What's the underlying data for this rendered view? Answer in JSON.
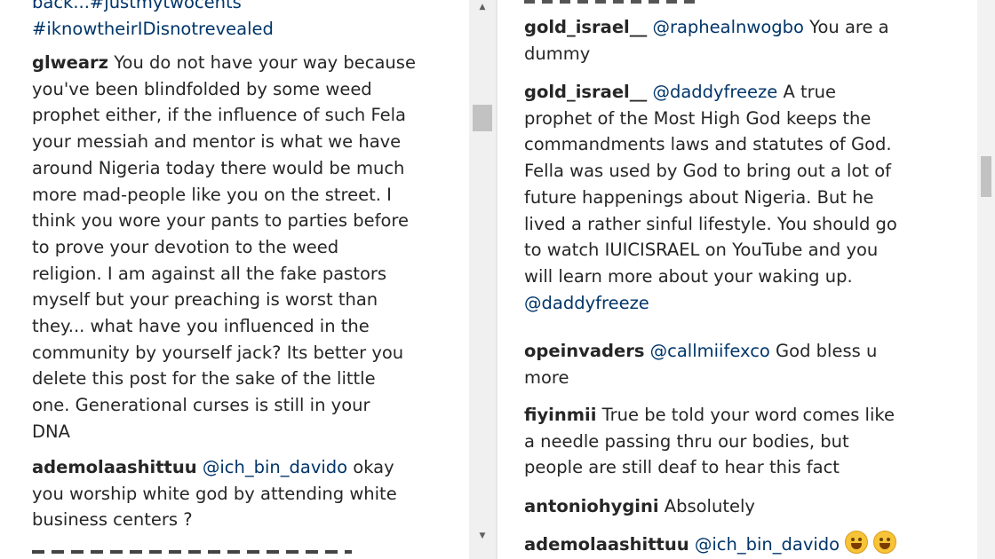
{
  "left": {
    "partial_top": [
      "back...#justmytwocents",
      "#iknowtheirIDisnotrevealed"
    ],
    "comment1": {
      "user": "glwearz",
      "lines": [
        " You do not have your way because",
        "you've been blindfolded by some weed",
        "prophet either, if the influence of such Fela",
        "your messiah and mentor is what we have",
        "around Nigeria today there would be much",
        "more mad-people like you on the street. I",
        "think you wore your pants to parties before",
        "to prove your devotion to the weed",
        "religion. I am against all the fake pastors",
        "myself but your preaching is worst than",
        "they... what have you influenced in the",
        "community by yourself jack? Its better you",
        "delete this post for the sake of the little",
        "one. Generational curses is still in your",
        "DNA"
      ]
    },
    "comment2": {
      "user": "ademolaashittuu",
      "mention": "@ich_bin_davido",
      "lines": [
        " okay",
        "you worship white god by attending white",
        "business centers ?"
      ]
    }
  },
  "right": {
    "comment1": {
      "user": "gold_israel__",
      "mention": "@raphealnwogbo",
      "lines": [
        " You are a",
        "dummy"
      ]
    },
    "comment2": {
      "user": "gold_israel__",
      "mention": "@daddyfreeze",
      "lines": [
        " A true",
        "prophet of the Most High God keeps the",
        "commandments laws and statutes of God.",
        "Fella was used by God to bring out a lot of",
        "future happenings about Nigeria. But he",
        "lived a rather sinful lifestyle. You should go",
        "to watch IUICISRAEL on YouTube and you",
        "will learn more about your waking up."
      ],
      "trailing_mention": "@daddyfreeze"
    },
    "comment3": {
      "user": "opeinvaders",
      "mention": "@callmiifexco",
      "lines": [
        " God bless u",
        "more"
      ]
    },
    "comment4": {
      "user": "fiyinmii",
      "lines": [
        " True be told your word comes like",
        "a needle passing thru our bodies, but",
        "people are still deaf to hear this fact"
      ]
    },
    "comment5": {
      "user": "antoniohygini",
      "lines": [
        " Absolutely"
      ]
    },
    "comment6": {
      "user": "ademolaashittuu",
      "mention": "@ich_bin_davido",
      "emoji": "grinning-face-emoji"
    }
  },
  "scroll": {
    "up_glyph": "▲",
    "down_glyph": "▼"
  }
}
